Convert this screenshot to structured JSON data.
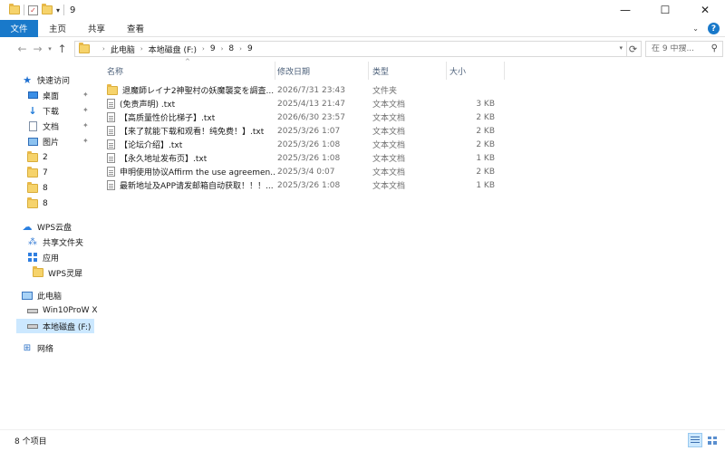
{
  "window": {
    "title": "9"
  },
  "ribbon": {
    "tabs": [
      "文件",
      "主页",
      "共享",
      "查看"
    ]
  },
  "address": {
    "crumbs": [
      "此电脑",
      "本地磁盘 (F:)",
      "9",
      "8",
      "9"
    ]
  },
  "search": {
    "placeholder": "在 9 中搜..."
  },
  "sidebar": {
    "quick_access": "快速访问",
    "pinned": [
      "桌面",
      "下载",
      "文档",
      "图片"
    ],
    "folders": [
      "2",
      "7",
      "8",
      "8"
    ],
    "wps_cloud": "WPS云盘",
    "shared_folder": "共享文件夹",
    "apps": "应用",
    "wps_app": "WPS灵犀",
    "this_pc": "此电脑",
    "drive1": "Win10ProW X",
    "drive2": "本地磁盘 (F:)",
    "network": "网络"
  },
  "columns": {
    "name": "名称",
    "date": "修改日期",
    "type": "类型",
    "size": "大小"
  },
  "files": [
    {
      "name": "退魔師レイナ2神聖村の妖魔襲変を調査...",
      "date": "2026/7/31 23:43",
      "type": "文件夹",
      "size": "",
      "icon": "folder-icon"
    },
    {
      "name": "(免责声明) .txt",
      "date": "2025/4/13 21:47",
      "type": "文本文档",
      "size": "3 KB",
      "icon": "text-file-icon"
    },
    {
      "name": "【高质量性价比梯子】.txt",
      "date": "2026/6/30 23:57",
      "type": "文本文档",
      "size": "2 KB",
      "icon": "text-file-icon"
    },
    {
      "name": "【来了就能下载和观看！纯免费！】.txt",
      "date": "2025/3/26 1:07",
      "type": "文本文档",
      "size": "2 KB",
      "icon": "text-file-icon"
    },
    {
      "name": "【论坛介绍】.txt",
      "date": "2025/3/26 1:08",
      "type": "文本文档",
      "size": "2 KB",
      "icon": "text-file-icon"
    },
    {
      "name": "【永久地址发布页】.txt",
      "date": "2025/3/26 1:08",
      "type": "文本文档",
      "size": "1 KB",
      "icon": "text-file-icon"
    },
    {
      "name": "申明使用协议Affirm the use agreemen...",
      "date": "2025/3/4 0:07",
      "type": "文本文档",
      "size": "2 KB",
      "icon": "text-file-icon"
    },
    {
      "name": "最新地址及APP请发邮箱自动获取！！！...",
      "date": "2025/3/26 1:08",
      "type": "文本文档",
      "size": "1 KB",
      "icon": "text-file-icon"
    }
  ],
  "status": {
    "item_count": "8 个项目"
  }
}
